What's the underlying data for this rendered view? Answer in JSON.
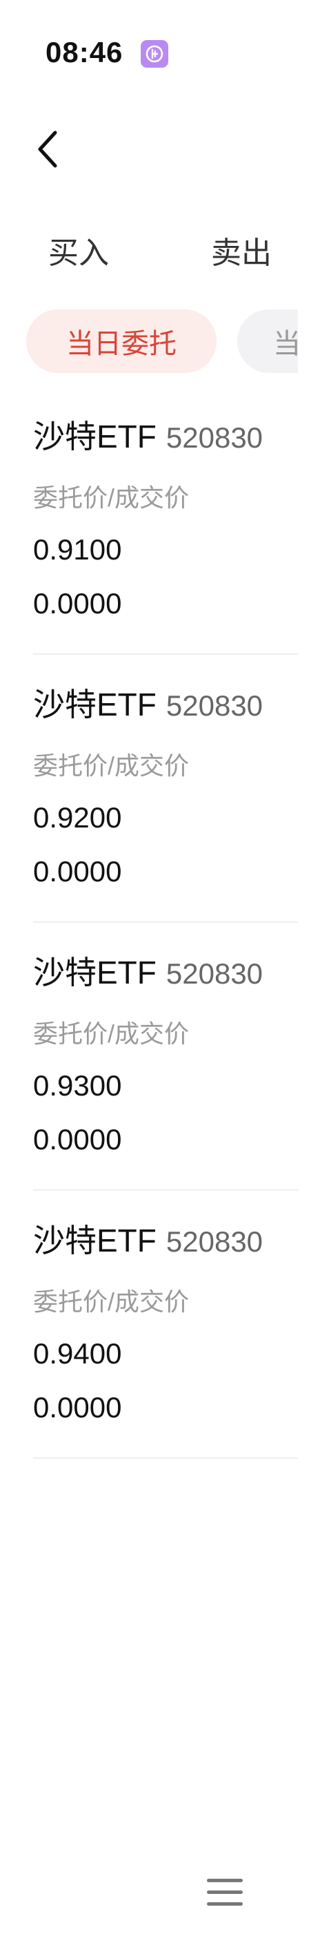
{
  "status_bar": {
    "time": "08:46",
    "app_icon": "purple-app-icon"
  },
  "nav": {
    "back_icon": "chevron-left-icon"
  },
  "trade_tabs": [
    {
      "label": "买入"
    },
    {
      "label": "卖出"
    }
  ],
  "filters": [
    {
      "label": "当日委托",
      "active": true
    },
    {
      "label": "当日成交",
      "active": false,
      "visible_text": "当"
    }
  ],
  "colors": {
    "accent": "#d64537",
    "accent_bg": "#fcecea",
    "chip_bg": "#f2f2f4",
    "label_gray": "#9a9a9a"
  },
  "orders": [
    {
      "name": "沙特ETF",
      "code": "520830",
      "label": "委托价/成交价",
      "order_price": "0.9100",
      "deal_price": "0.0000"
    },
    {
      "name": "沙特ETF",
      "code": "520830",
      "label": "委托价/成交价",
      "order_price": "0.9200",
      "deal_price": "0.0000"
    },
    {
      "name": "沙特ETF",
      "code": "520830",
      "label": "委托价/成交价",
      "order_price": "0.9300",
      "deal_price": "0.0000"
    },
    {
      "name": "沙特ETF",
      "code": "520830",
      "label": "委托价/成交价",
      "order_price": "0.9400",
      "deal_price": "0.0000"
    }
  ],
  "bottom": {
    "menu_icon": "hamburger-menu-icon"
  }
}
